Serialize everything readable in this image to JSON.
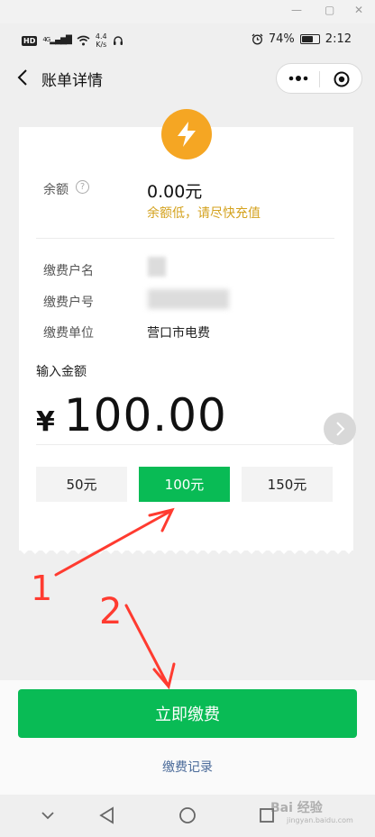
{
  "status": {
    "speed_top": "4.4",
    "speed_bottom": "K/s",
    "battery": "74%",
    "battery_fraction": 0.74,
    "time": "2:12",
    "signal": "4G"
  },
  "nav": {
    "title": "账单详情"
  },
  "balance": {
    "label": "余额",
    "value": "0.00元",
    "warning": "余额低，请尽快充值"
  },
  "account": {
    "name_label": "缴费户名",
    "number_label": "缴费户号",
    "unit_label": "缴费单位",
    "unit_value": "营口市电费"
  },
  "amount": {
    "label": "输入金额",
    "currency": "¥",
    "value": "100.00"
  },
  "chips": [
    {
      "label": "50元",
      "selected": false
    },
    {
      "label": "100元",
      "selected": true
    },
    {
      "label": "150元",
      "selected": false
    }
  ],
  "actions": {
    "pay": "立即缴费",
    "records": "缴费记录"
  },
  "annotations": {
    "mark1": "1",
    "mark2": "2"
  },
  "watermark": {
    "text": "Bai 经验",
    "sub": "jingyan.baidu.com"
  },
  "colors": {
    "accent": "#09bb55",
    "warning": "#d4a21e",
    "icon_bg": "#f5a623",
    "annotation": "#ff3b30"
  }
}
